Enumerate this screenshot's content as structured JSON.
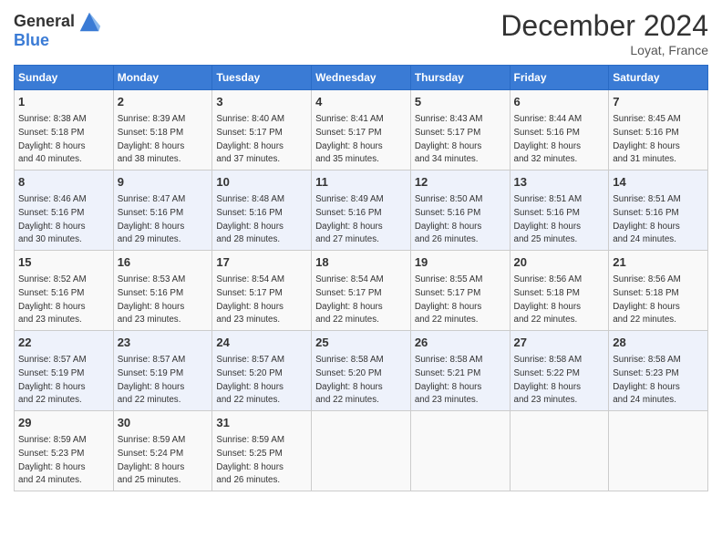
{
  "header": {
    "logo_line1": "General",
    "logo_line2": "Blue",
    "month": "December 2024",
    "location": "Loyat, France"
  },
  "weekdays": [
    "Sunday",
    "Monday",
    "Tuesday",
    "Wednesday",
    "Thursday",
    "Friday",
    "Saturday"
  ],
  "weeks": [
    [
      {
        "day": "1",
        "lines": [
          "Sunrise: 8:38 AM",
          "Sunset: 5:18 PM",
          "Daylight: 8 hours",
          "and 40 minutes."
        ]
      },
      {
        "day": "2",
        "lines": [
          "Sunrise: 8:39 AM",
          "Sunset: 5:18 PM",
          "Daylight: 8 hours",
          "and 38 minutes."
        ]
      },
      {
        "day": "3",
        "lines": [
          "Sunrise: 8:40 AM",
          "Sunset: 5:17 PM",
          "Daylight: 8 hours",
          "and 37 minutes."
        ]
      },
      {
        "day": "4",
        "lines": [
          "Sunrise: 8:41 AM",
          "Sunset: 5:17 PM",
          "Daylight: 8 hours",
          "and 35 minutes."
        ]
      },
      {
        "day": "5",
        "lines": [
          "Sunrise: 8:43 AM",
          "Sunset: 5:17 PM",
          "Daylight: 8 hours",
          "and 34 minutes."
        ]
      },
      {
        "day": "6",
        "lines": [
          "Sunrise: 8:44 AM",
          "Sunset: 5:16 PM",
          "Daylight: 8 hours",
          "and 32 minutes."
        ]
      },
      {
        "day": "7",
        "lines": [
          "Sunrise: 8:45 AM",
          "Sunset: 5:16 PM",
          "Daylight: 8 hours",
          "and 31 minutes."
        ]
      }
    ],
    [
      {
        "day": "8",
        "lines": [
          "Sunrise: 8:46 AM",
          "Sunset: 5:16 PM",
          "Daylight: 8 hours",
          "and 30 minutes."
        ]
      },
      {
        "day": "9",
        "lines": [
          "Sunrise: 8:47 AM",
          "Sunset: 5:16 PM",
          "Daylight: 8 hours",
          "and 29 minutes."
        ]
      },
      {
        "day": "10",
        "lines": [
          "Sunrise: 8:48 AM",
          "Sunset: 5:16 PM",
          "Daylight: 8 hours",
          "and 28 minutes."
        ]
      },
      {
        "day": "11",
        "lines": [
          "Sunrise: 8:49 AM",
          "Sunset: 5:16 PM",
          "Daylight: 8 hours",
          "and 27 minutes."
        ]
      },
      {
        "day": "12",
        "lines": [
          "Sunrise: 8:50 AM",
          "Sunset: 5:16 PM",
          "Daylight: 8 hours",
          "and 26 minutes."
        ]
      },
      {
        "day": "13",
        "lines": [
          "Sunrise: 8:51 AM",
          "Sunset: 5:16 PM",
          "Daylight: 8 hours",
          "and 25 minutes."
        ]
      },
      {
        "day": "14",
        "lines": [
          "Sunrise: 8:51 AM",
          "Sunset: 5:16 PM",
          "Daylight: 8 hours",
          "and 24 minutes."
        ]
      }
    ],
    [
      {
        "day": "15",
        "lines": [
          "Sunrise: 8:52 AM",
          "Sunset: 5:16 PM",
          "Daylight: 8 hours",
          "and 23 minutes."
        ]
      },
      {
        "day": "16",
        "lines": [
          "Sunrise: 8:53 AM",
          "Sunset: 5:16 PM",
          "Daylight: 8 hours",
          "and 23 minutes."
        ]
      },
      {
        "day": "17",
        "lines": [
          "Sunrise: 8:54 AM",
          "Sunset: 5:17 PM",
          "Daylight: 8 hours",
          "and 23 minutes."
        ]
      },
      {
        "day": "18",
        "lines": [
          "Sunrise: 8:54 AM",
          "Sunset: 5:17 PM",
          "Daylight: 8 hours",
          "and 22 minutes."
        ]
      },
      {
        "day": "19",
        "lines": [
          "Sunrise: 8:55 AM",
          "Sunset: 5:17 PM",
          "Daylight: 8 hours",
          "and 22 minutes."
        ]
      },
      {
        "day": "20",
        "lines": [
          "Sunrise: 8:56 AM",
          "Sunset: 5:18 PM",
          "Daylight: 8 hours",
          "and 22 minutes."
        ]
      },
      {
        "day": "21",
        "lines": [
          "Sunrise: 8:56 AM",
          "Sunset: 5:18 PM",
          "Daylight: 8 hours",
          "and 22 minutes."
        ]
      }
    ],
    [
      {
        "day": "22",
        "lines": [
          "Sunrise: 8:57 AM",
          "Sunset: 5:19 PM",
          "Daylight: 8 hours",
          "and 22 minutes."
        ]
      },
      {
        "day": "23",
        "lines": [
          "Sunrise: 8:57 AM",
          "Sunset: 5:19 PM",
          "Daylight: 8 hours",
          "and 22 minutes."
        ]
      },
      {
        "day": "24",
        "lines": [
          "Sunrise: 8:57 AM",
          "Sunset: 5:20 PM",
          "Daylight: 8 hours",
          "and 22 minutes."
        ]
      },
      {
        "day": "25",
        "lines": [
          "Sunrise: 8:58 AM",
          "Sunset: 5:20 PM",
          "Daylight: 8 hours",
          "and 22 minutes."
        ]
      },
      {
        "day": "26",
        "lines": [
          "Sunrise: 8:58 AM",
          "Sunset: 5:21 PM",
          "Daylight: 8 hours",
          "and 23 minutes."
        ]
      },
      {
        "day": "27",
        "lines": [
          "Sunrise: 8:58 AM",
          "Sunset: 5:22 PM",
          "Daylight: 8 hours",
          "and 23 minutes."
        ]
      },
      {
        "day": "28",
        "lines": [
          "Sunrise: 8:58 AM",
          "Sunset: 5:23 PM",
          "Daylight: 8 hours",
          "and 24 minutes."
        ]
      }
    ],
    [
      {
        "day": "29",
        "lines": [
          "Sunrise: 8:59 AM",
          "Sunset: 5:23 PM",
          "Daylight: 8 hours",
          "and 24 minutes."
        ]
      },
      {
        "day": "30",
        "lines": [
          "Sunrise: 8:59 AM",
          "Sunset: 5:24 PM",
          "Daylight: 8 hours",
          "and 25 minutes."
        ]
      },
      {
        "day": "31",
        "lines": [
          "Sunrise: 8:59 AM",
          "Sunset: 5:25 PM",
          "Daylight: 8 hours",
          "and 26 minutes."
        ]
      },
      {
        "day": "",
        "lines": []
      },
      {
        "day": "",
        "lines": []
      },
      {
        "day": "",
        "lines": []
      },
      {
        "day": "",
        "lines": []
      }
    ]
  ]
}
